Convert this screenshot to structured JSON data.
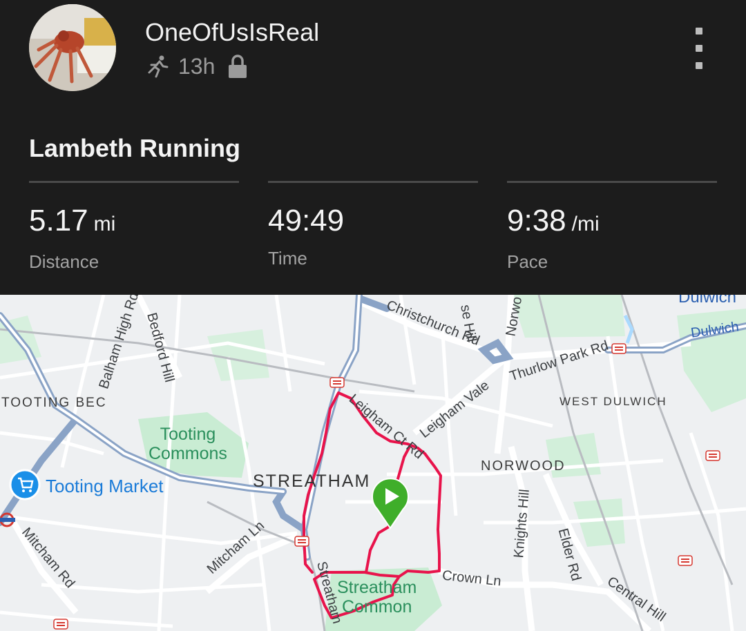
{
  "user": {
    "name": "OneOfUsIsReal",
    "time_ago": "13h",
    "activity_icon": "running-person-icon",
    "privacy_icon": "lock-icon"
  },
  "activity": {
    "title": "Lambeth Running"
  },
  "stats": [
    {
      "value": "5.17",
      "unit": "mi",
      "label": "Distance"
    },
    {
      "value": "49:49",
      "unit": "",
      "label": "Time"
    },
    {
      "value": "9:38",
      "unit": "/mi",
      "label": "Pace"
    }
  ],
  "map": {
    "labels": {
      "tooting_bec": "TOOTING BEC",
      "tooting_commons": "Tooting\nCommons",
      "tooting_market": "Tooting Market",
      "streatham": "STREATHAM",
      "streatham_common": "Streatham\nCommon",
      "norwood": "NORWOOD",
      "west_dulwich": "WEST DULWICH",
      "dulwich_top": "Dulwich",
      "dulwich_right": "Dulwich",
      "balham_high_rd": "Balham High Rd",
      "bedford_hill": "Bedford Hill",
      "christchurch_rd": "Christchurch Rd",
      "thurlow_park_rd": "Thurlow Park Rd",
      "leigham_vale": "Leigham Vale",
      "leigham_ct_rd": "Leigham Ct Rd",
      "knights_hill": "Knights Hill",
      "elder_rd": "Elder Rd",
      "crown_ln": "Crown Ln",
      "central_hill": "Central Hill",
      "mitcham_ln": "Mitcham Ln",
      "mitcham_rd": "Mitcham Rd",
      "streatham_high_rd": "Streatham",
      "norwood_rd": "Norwo",
      "tulse_hill": "se Hill"
    },
    "colors": {
      "route": "#e8134b",
      "start_marker": "#3fae2a",
      "park": "#c9ecd3",
      "water": "#aadaff",
      "major_road": "#8aa3c6"
    }
  }
}
